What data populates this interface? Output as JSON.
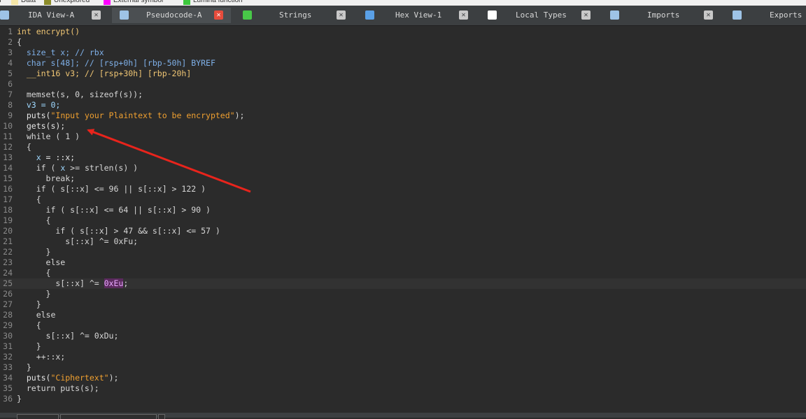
{
  "legend": [
    {
      "label": "n",
      "color": ""
    },
    {
      "label": "Data",
      "color": "#f5e6a8"
    },
    {
      "label": "Unexplored",
      "color": "#8c8c2a"
    },
    {
      "label": "External symbol",
      "color": "#ff00ff"
    },
    {
      "label": "Lumina function",
      "color": "#3cc83c"
    }
  ],
  "tabs": [
    {
      "label": "IDA View-A",
      "icon": "ida-view-icon",
      "icon_color": "#9ec3e6",
      "active": false
    },
    {
      "label": "Pseudocode-A",
      "icon": "pseudocode-icon",
      "icon_color": "#9ec3e6",
      "active": true
    },
    {
      "label": "Strings",
      "icon": "strings-icon",
      "icon_color": "#48c848",
      "active": false
    },
    {
      "label": "Hex View-1",
      "icon": "hex-view-icon",
      "icon_color": "#5aa0e6",
      "active": false
    },
    {
      "label": "Local Types",
      "icon": "local-types-icon",
      "icon_color": "#ffffff",
      "active": false
    },
    {
      "label": "Imports",
      "icon": "imports-icon",
      "icon_color": "#9ec3e6",
      "active": false
    },
    {
      "label": "Exports",
      "icon": "exports-icon",
      "icon_color": "#9ec3e6",
      "active": false
    }
  ],
  "close_glyph": "✕",
  "code": [
    {
      "n": "1",
      "tokens": [
        {
          "t": "int encrypt()",
          "c": "decl"
        }
      ]
    },
    {
      "n": "2",
      "tokens": [
        {
          "t": "{",
          "c": "plain"
        }
      ]
    },
    {
      "n": "3",
      "tokens": [
        {
          "t": "  size_t x; // rbx",
          "c": "cmt"
        }
      ]
    },
    {
      "n": "4",
      "tokens": [
        {
          "t": "  char s[48]; // [rsp+0h] [rbp-50h] BYREF",
          "c": "cmt"
        }
      ]
    },
    {
      "n": "5",
      "tokens": [
        {
          "t": "  __int16 v3; // [rsp+30h] [rbp-20h]",
          "c": "decl"
        }
      ]
    },
    {
      "n": "6",
      "tokens": []
    },
    {
      "n": "7",
      "tokens": [
        {
          "t": "  memset(s, 0, sizeof(s));",
          "c": "plain"
        }
      ]
    },
    {
      "n": "8",
      "tokens": [
        {
          "t": "  v3 = 0;",
          "c": "var"
        }
      ]
    },
    {
      "n": "9",
      "tokens": [
        {
          "t": "  puts(",
          "c": "fn"
        },
        {
          "t": "\"Input your Plaintext to be encrypted\"",
          "c": "str"
        },
        {
          "t": ");",
          "c": "plain"
        }
      ]
    },
    {
      "n": "10",
      "tokens": [
        {
          "t": "  gets(s);",
          "c": "fn"
        }
      ]
    },
    {
      "n": "11",
      "tokens": [
        {
          "t": "  while ( 1 )",
          "c": "plain"
        }
      ]
    },
    {
      "n": "12",
      "tokens": [
        {
          "t": "  {",
          "c": "plain"
        }
      ]
    },
    {
      "n": "13",
      "tokens": [
        {
          "t": "    x",
          "c": "var"
        },
        {
          "t": " = ::x;",
          "c": "global"
        }
      ]
    },
    {
      "n": "14",
      "tokens": [
        {
          "t": "    if ( ",
          "c": "plain"
        },
        {
          "t": "x",
          "c": "var"
        },
        {
          "t": " >= strlen(s) )",
          "c": "plain"
        }
      ]
    },
    {
      "n": "15",
      "tokens": [
        {
          "t": "      break;",
          "c": "plain"
        }
      ]
    },
    {
      "n": "16",
      "tokens": [
        {
          "t": "    if ( s[::x] <= 96 || s[::x] > 122 )",
          "c": "plain"
        }
      ]
    },
    {
      "n": "17",
      "tokens": [
        {
          "t": "    {",
          "c": "plain"
        }
      ]
    },
    {
      "n": "18",
      "tokens": [
        {
          "t": "      if ( s[::x] <= 64 || s[::x] > 90 )",
          "c": "plain"
        }
      ]
    },
    {
      "n": "19",
      "tokens": [
        {
          "t": "      {",
          "c": "plain"
        }
      ]
    },
    {
      "n": "20",
      "tokens": [
        {
          "t": "        if ( s[::x] > 47 && s[::x] <= 57 )",
          "c": "plain"
        }
      ]
    },
    {
      "n": "21",
      "tokens": [
        {
          "t": "          s[::x] ^= 0xFu;",
          "c": "plain"
        }
      ]
    },
    {
      "n": "22",
      "tokens": [
        {
          "t": "      }",
          "c": "plain"
        }
      ]
    },
    {
      "n": "23",
      "tokens": [
        {
          "t": "      else",
          "c": "plain"
        }
      ]
    },
    {
      "n": "24",
      "tokens": [
        {
          "t": "      {",
          "c": "plain"
        }
      ]
    },
    {
      "n": "25",
      "tokens": [
        {
          "t": "        s[::x] ^= ",
          "c": "plain"
        },
        {
          "t": "0xEu",
          "c": "hl"
        },
        {
          "t": ";",
          "c": "plain"
        }
      ],
      "highlight": true
    },
    {
      "n": "26",
      "tokens": [
        {
          "t": "      }",
          "c": "plain"
        }
      ]
    },
    {
      "n": "27",
      "tokens": [
        {
          "t": "    }",
          "c": "plain"
        }
      ]
    },
    {
      "n": "28",
      "tokens": [
        {
          "t": "    else",
          "c": "plain"
        }
      ]
    },
    {
      "n": "29",
      "tokens": [
        {
          "t": "    {",
          "c": "plain"
        }
      ]
    },
    {
      "n": "30",
      "tokens": [
        {
          "t": "      s[::x] ^= 0xDu;",
          "c": "plain"
        }
      ]
    },
    {
      "n": "31",
      "tokens": [
        {
          "t": "    }",
          "c": "plain"
        }
      ]
    },
    {
      "n": "32",
      "tokens": [
        {
          "t": "    ++::x;",
          "c": "plain"
        }
      ]
    },
    {
      "n": "33",
      "tokens": [
        {
          "t": "  }",
          "c": "plain"
        }
      ]
    },
    {
      "n": "34",
      "tokens": [
        {
          "t": "  puts(",
          "c": "fn"
        },
        {
          "t": "\"Ciphertext\"",
          "c": "str"
        },
        {
          "t": ");",
          "c": "plain"
        }
      ]
    },
    {
      "n": "35",
      "tokens": [
        {
          "t": "  return puts(s);",
          "c": "plain"
        }
      ]
    },
    {
      "n": "36",
      "tokens": [
        {
          "t": "}",
          "c": "plain"
        }
      ]
    }
  ],
  "annotation_color": "#e8241c"
}
